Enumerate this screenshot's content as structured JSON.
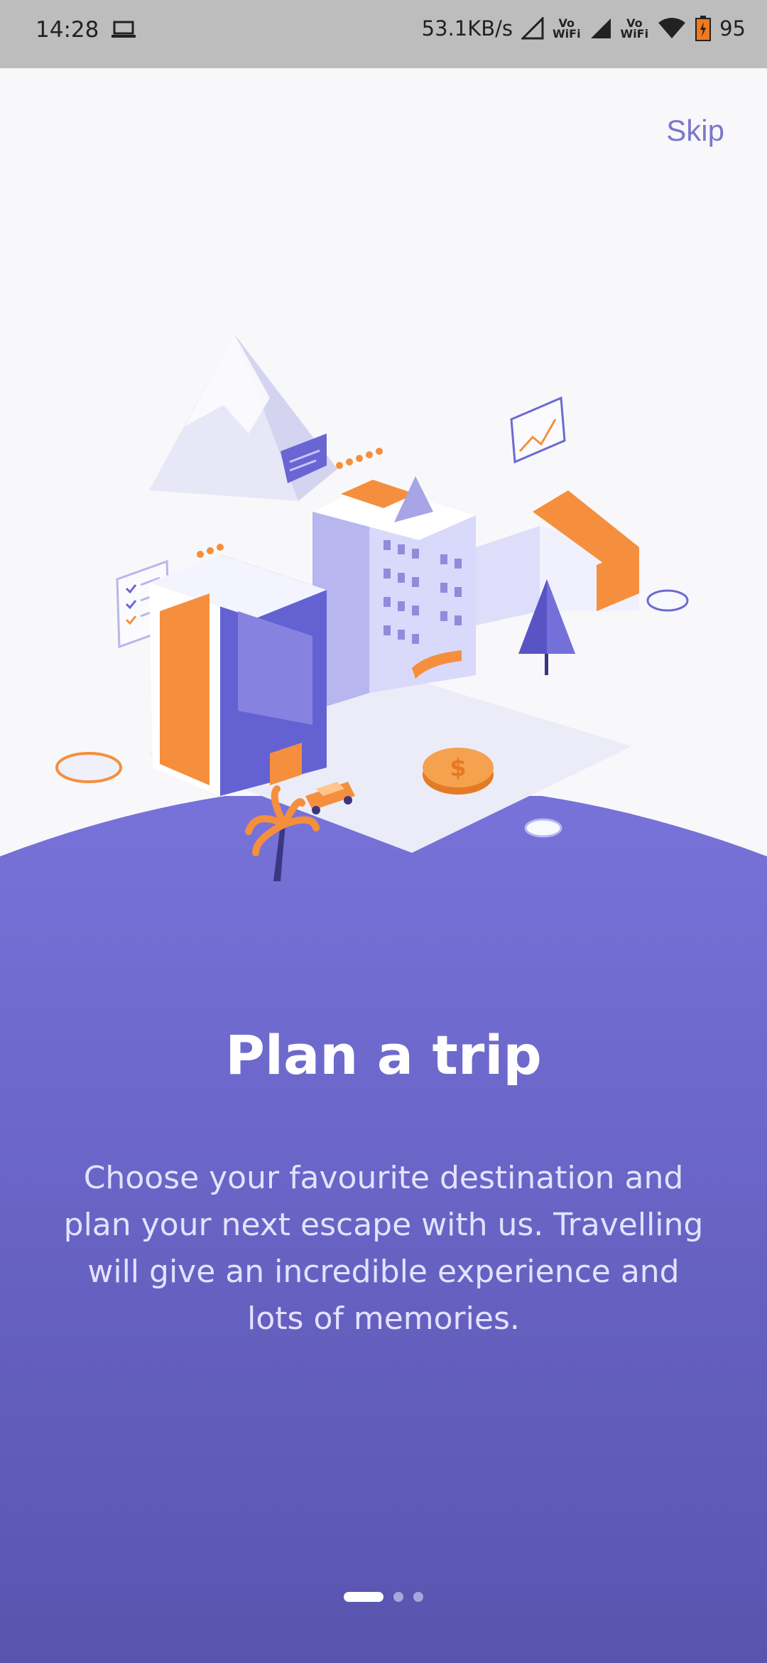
{
  "status_bar": {
    "time": "14:28",
    "speed": "53.1KB/s",
    "vowifi_1": "Vo\nWiFi",
    "vowifi_2": "Vo\nWiFi",
    "battery": "95",
    "icons": [
      "laptop-icon",
      "signal-icon",
      "wifi-icon",
      "battery-icon"
    ]
  },
  "header": {
    "skip_label": "Skip"
  },
  "onboarding": {
    "title": "Plan a trip",
    "description": "Choose your favourite destination and plan your next escape with us. Travelling will give an incredible experience and lots of memories.",
    "pages": 3,
    "current_page": 1
  },
  "colors": {
    "accent": "#7570d8",
    "accent_dark": "#5a55b0",
    "orange": "#f58f3d",
    "skip_text": "#7b78c9"
  }
}
